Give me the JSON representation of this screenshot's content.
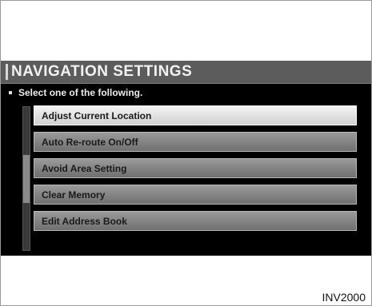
{
  "screen": {
    "title": "NAVIGATION SETTINGS",
    "instruction": "Select one of the following."
  },
  "menu": {
    "items": [
      {
        "label": "Adjust Current Location",
        "selected": true
      },
      {
        "label": "Auto Re-route On/Off",
        "selected": false
      },
      {
        "label": "Avoid Area Setting",
        "selected": false
      },
      {
        "label": "Clear Memory",
        "selected": false
      },
      {
        "label": "Edit Address Book",
        "selected": false
      }
    ]
  },
  "caption": "INV2000"
}
